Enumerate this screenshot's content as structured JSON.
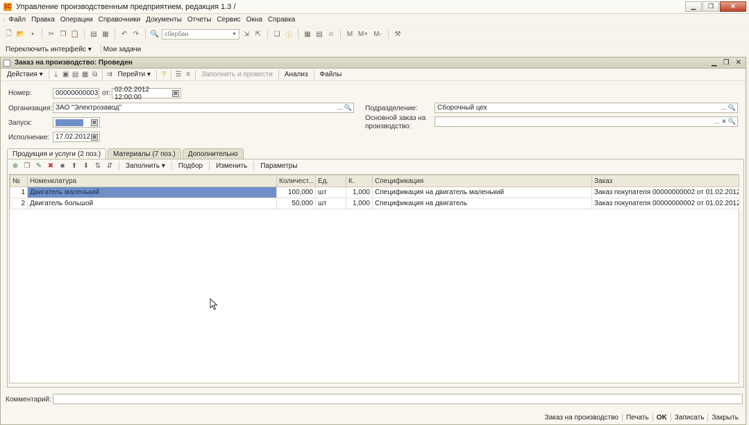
{
  "window": {
    "title": "Управление производственным предприятием, редакция 1.3 /"
  },
  "menu": [
    "Файл",
    "Правка",
    "Операции",
    "Справочники",
    "Документы",
    "Отчеты",
    "Сервис",
    "Окна",
    "Справка"
  ],
  "toolbar": {
    "search_value": "сбербан",
    "m_buttons": [
      "M",
      "M+",
      "M-"
    ]
  },
  "panel": {
    "switch_interface": "Переключить интерфейс",
    "my_tasks": "Мои задачи"
  },
  "document": {
    "title": "Заказ на производство: Проведен",
    "actions": "Действия",
    "goto": "Перейти",
    "fill_and_post": "Заполнить и провести",
    "analysis": "Анализ",
    "files": "Файлы",
    "fields": {
      "number_label": "Номер:",
      "number_value": "00000000003",
      "date_label": "от:",
      "date_value": "02.02.2012 12:00:00",
      "org_label": "Организация:",
      "org_value": "ЗАО \"Электрозавод\"",
      "launch_label": "Запуск:",
      "exec_label": "Исполнение:",
      "exec_value": "17.02.2012",
      "dept_label": "Подразделение:",
      "dept_value": "Сборочный цех",
      "base_order_label_1": "Основной заказ на",
      "base_order_label_2": "производство:"
    },
    "tabs": [
      "Продукция и услуги (2 поз.)",
      "Материалы (7 поз.)",
      "Дополнительно"
    ],
    "table_toolbar": {
      "fill": "Заполнить",
      "select": "Подбор",
      "change": "Изменить",
      "params": "Параметры"
    },
    "table": {
      "headers": [
        "№",
        "Номенклатура",
        "Количест...",
        "Ед.",
        "К.",
        "Спецификация",
        "Заказ"
      ],
      "rows": [
        [
          "1",
          "Двигатель маленький",
          "100,000",
          "шт",
          "1,000",
          "Спецификация на двигатель маленький",
          "Заказ покупателя 00000000002 от 01.02.2012 ..."
        ],
        [
          "2",
          "Двигатель большой",
          "50,000",
          "шт",
          "1,000",
          "Спецификация на двигатель",
          "Заказ покупателя 00000000002 от 01.02.2012 ..."
        ]
      ]
    },
    "comment_label": "Комментарий:",
    "status_bar": [
      "Заказ на производство",
      "Печать",
      "OK",
      "Записать",
      "Закрыть"
    ]
  },
  "colors": {
    "accent": "#6f8fc8",
    "background": "#f3f0e6"
  }
}
